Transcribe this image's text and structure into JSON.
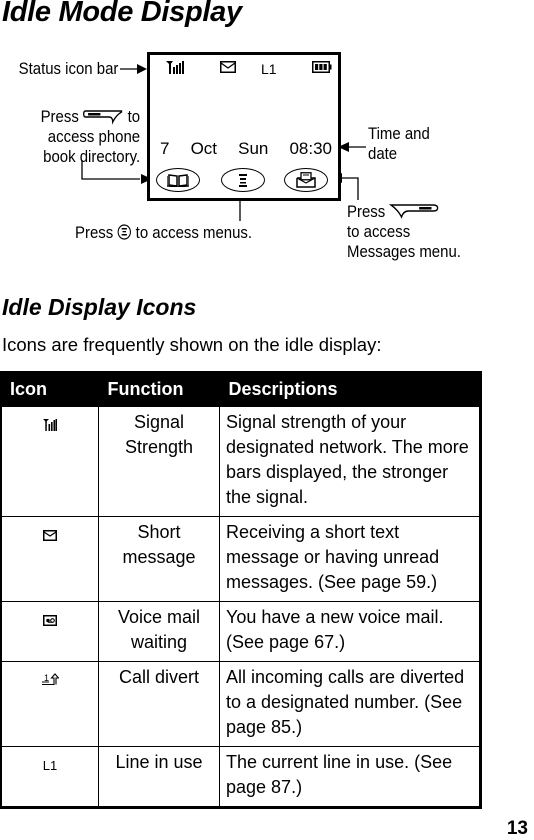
{
  "page": {
    "title": "Idle Mode Display",
    "page_number": "13"
  },
  "diagram": {
    "status_bar_label": "Status icon bar",
    "phonebook_press": "Press",
    "phonebook_to": "to",
    "phonebook_line2": "access phone",
    "phonebook_line3": "book directory.",
    "time_date_line1": "Time and",
    "time_date_line2": "date",
    "messages_press": "Press",
    "messages_line2": "to access",
    "messages_line3": "Messages menu.",
    "menus_press": "Press",
    "menus_rest": "to access menus.",
    "lcd": {
      "line_indicator": "L1",
      "day": "7",
      "month": "Oct",
      "weekday": "Sun",
      "time": "08:30",
      "status_icons": [
        "signal-strength-icon",
        "envelope-icon",
        "line-indicator",
        "battery-icon"
      ],
      "softkey_icons": [
        "phonebook-icon",
        "menu-icon",
        "messages-icon"
      ]
    }
  },
  "section": {
    "heading": "Idle Display Icons",
    "intro": "Icons are frequently shown on the idle display:"
  },
  "table": {
    "headers": [
      "Icon",
      "Function",
      "Descriptions"
    ],
    "rows": [
      {
        "icon": "signal-strength-icon",
        "function": "Signal Strength",
        "description": "Signal strength of your designated network. The more bars displayed, the stronger the signal."
      },
      {
        "icon": "short-message-icon",
        "function": "Short message",
        "description": "Receiving a short text message or having unread messages. (See page 59.)"
      },
      {
        "icon": "voice-mail-icon",
        "function": "Voice mail waiting",
        "description": "You have a new voice mail. (See page 67.)"
      },
      {
        "icon": "call-divert-icon",
        "function": "Call divert",
        "description": "All incoming calls are diverted to a designated number. (See page 85.)"
      },
      {
        "icon": "line-in-use-icon",
        "icon_text": "L1",
        "function": "Line in use",
        "description": "The current line in use. (See page 87.)"
      }
    ]
  }
}
